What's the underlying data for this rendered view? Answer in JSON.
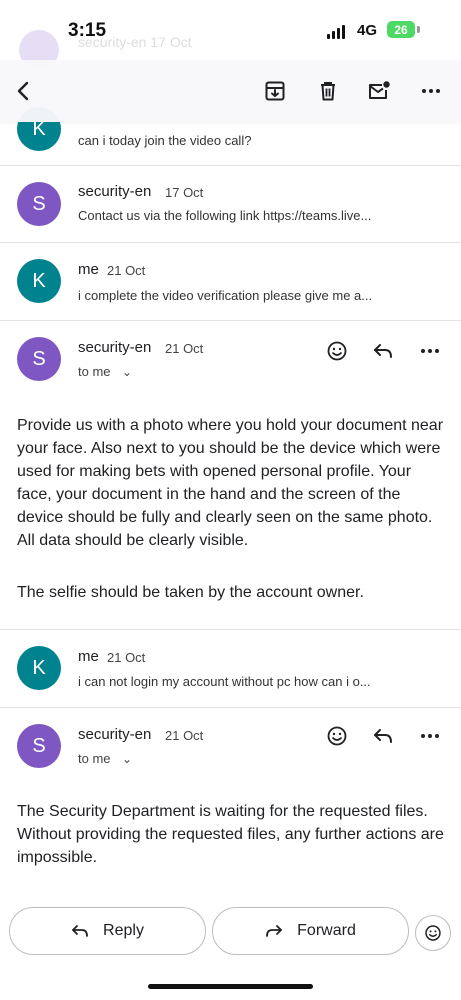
{
  "status_bar": {
    "time": "3:15",
    "network": "4G",
    "battery": "26"
  },
  "ghost": {
    "text": "security-en  17 Oct"
  },
  "toolbar": {
    "icons": [
      "back-arrow-icon",
      "archive-icon",
      "trash-icon",
      "mark-unread-icon",
      "more-icon"
    ]
  },
  "messages": [
    {
      "sender": "",
      "date": "",
      "snippet": "can i today join the video call?",
      "avatar": "K"
    },
    {
      "sender": "security-en",
      "date": "17 Oct",
      "snippet": "Contact us via the following link https://teams.live...",
      "avatar": "S"
    },
    {
      "sender": "me",
      "date": "21 Oct",
      "snippet": "i complete the video verification please give me a...",
      "avatar": "K"
    },
    {
      "sender": "security-en",
      "date": "21 Oct",
      "to_label": "to me",
      "avatar": "S",
      "body_1": "Provide us with a photo where you hold your document near your face. Also next to you should be the device which were used for making bets with opened personal profile. Your face, your document in the hand and the screen of the device should be fully and clearly seen on the same photo. All data should be clearly visible.",
      "body_2": "The selfie should be taken by the account owner."
    },
    {
      "sender": "me",
      "date": "21 Oct",
      "snippet": "i can not login my account without pc how can i o...",
      "avatar": "K"
    },
    {
      "sender": "security-en",
      "date": "21 Oct",
      "to_label": "to me",
      "avatar": "S",
      "body_1": "The Security Department is waiting for the requested files. Without providing the requested files, any further actions are impossible."
    }
  ],
  "bottom": {
    "reply_label": "Reply",
    "forward_label": "Forward"
  }
}
